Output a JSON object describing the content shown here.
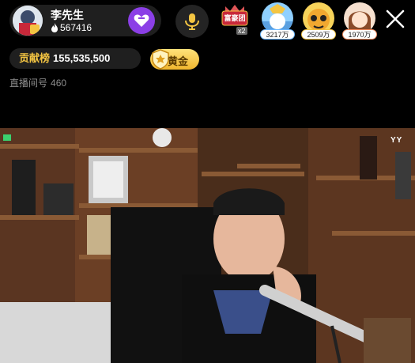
{
  "host": {
    "name": "李先生",
    "follower_count": "567416"
  },
  "fan_club": {
    "label": "富豪团",
    "multiplier": "x2"
  },
  "top_viewers": [
    {
      "score": "3217万"
    },
    {
      "score": "2509万"
    },
    {
      "score": "1970万"
    }
  ],
  "contribution": {
    "label": "贡献榜",
    "value": "155,535,500"
  },
  "level": {
    "label": "黄金"
  },
  "room": {
    "label": "直播间号",
    "id": "460"
  },
  "video": {
    "watermark": "YY"
  },
  "colors": {
    "accent_purple": "#8b3fe6",
    "gold": "#f4c542",
    "background": "#000000"
  },
  "icons": [
    "flame-icon",
    "heart-icon",
    "mic-icon",
    "close-icon",
    "crown-icon"
  ]
}
